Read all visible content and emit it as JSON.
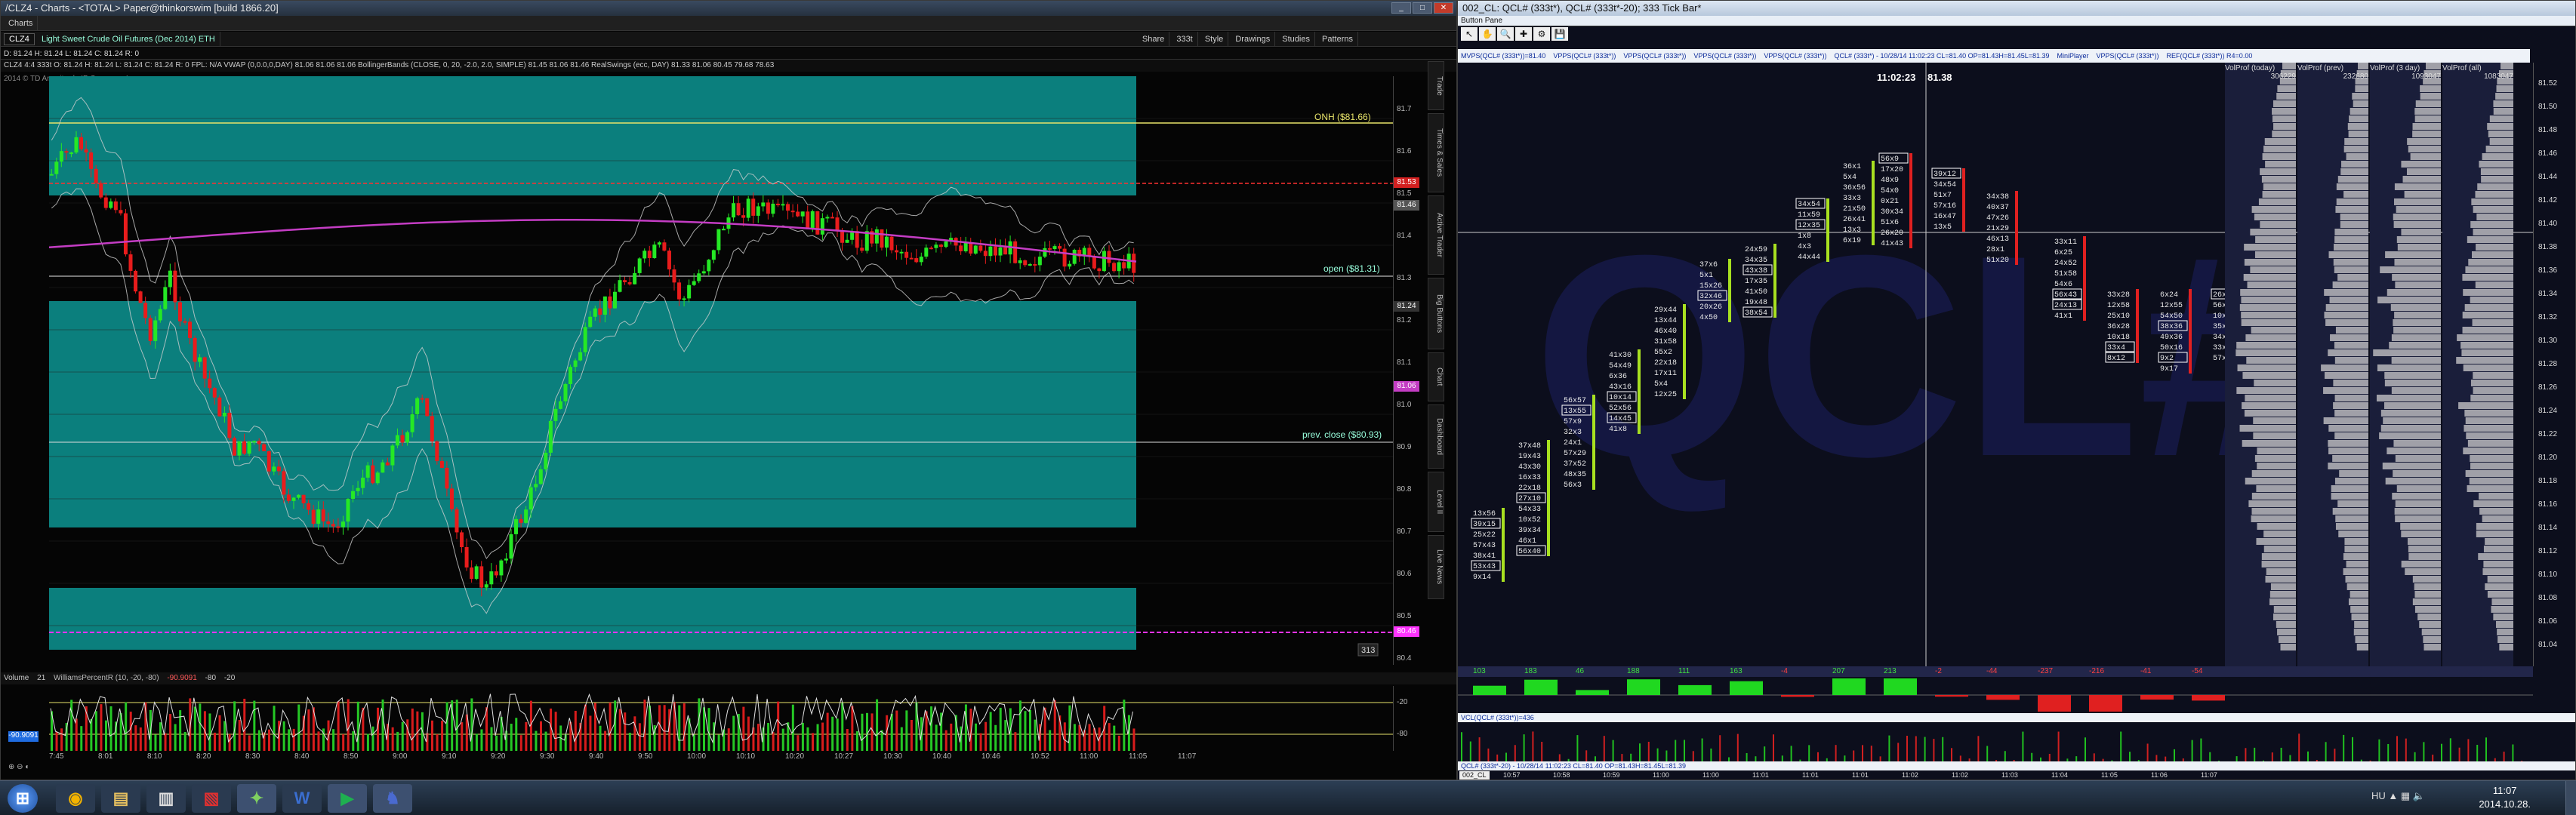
{
  "left": {
    "title": "/CLZ4 - Charts - <TOTAL> Paper@thinkorswim [build 1866.20]",
    "charts_label": "Charts",
    "symbol": "CLZ4",
    "description": "Light Sweet Crude Oil Futures (Dec 2014) ETH",
    "quote": "D: 81.24  H: 81.24  L: 81.24  C: 81.24  R: 0",
    "tools": [
      "Share",
      "333t",
      "Style",
      "Drawings",
      "Studies",
      "Patterns"
    ],
    "studies_line": "CLZ4 4:4 333t   O: 81.24  H: 81.24  L: 81.24  C: 81.24  R: 0   FPL: N/A   VWAP (0,0.0,0,DAY)  81.06  81.06  81.06   BollingerBands (CLOSE, 0, 20, -2.0, 2.0, SIMPLE)  81.45  81.06  81.46   RealSwings (ecc, DAY)  81.33  81.06  80.45  79.68  78.63",
    "copyright": "2014 © TD Ameritrade IP Company, Inc.",
    "labels": {
      "onh": "ONH ($81.66)",
      "open": "open ($81.31)",
      "prev_close": "prev. close ($80.93)"
    },
    "price_ticks": [
      "81.7",
      "81.6",
      "81.5",
      "81.4",
      "81.3",
      "81.2",
      "81.1",
      "81.0",
      "80.9",
      "80.8",
      "80.7",
      "80.6",
      "80.5",
      "80.4"
    ],
    "price_cells": {
      "p1": "81.53",
      "p2": "81.46",
      "p3": "81.24",
      "p4": "81.06",
      "p5": "80.46"
    },
    "count_badge": "313",
    "lower_study": {
      "volume": "Volume",
      "vol_val": "21",
      "label": "WilliamsPercentR (10, -20, -80)",
      "val": "-90.9091",
      "l1": "-80",
      "l2": "-20"
    },
    "lower_ticks": [
      "-20",
      "-80"
    ],
    "time_ticks": [
      "7:45",
      "8:01",
      "8:10",
      "8:20",
      "8:30",
      "8:40",
      "8:50",
      "9:00",
      "9:10",
      "9:20",
      "9:30",
      "9:40",
      "9:50",
      "10:00",
      "10:10",
      "10:20",
      "10:27",
      "10:30",
      "10:40",
      "10:46",
      "10:52",
      "11:00",
      "11:05",
      "11:07"
    ],
    "side_tabs": [
      "Trade",
      "Times & Sales",
      "Active Trader",
      "Big Buttons",
      "Chart",
      "Dashboard",
      "Level II",
      "Live News"
    ],
    "colors": {
      "teal": "#0b7f7d",
      "up": "#25e825",
      "down": "#e81c1c",
      "vwap": "#c43dc4"
    }
  },
  "right": {
    "title": "002_CL: QCL# (333t*), QCL# (333t*-20); 333 Tick Bar*",
    "menu": "Button Pane",
    "header_items": [
      "MVPS(QCL# (333t*))=81.40",
      "VPPS(QCL# (333t*))",
      "VPPS(QCL# (333t*))",
      "VPPS(QCL# (333t*))",
      "VPPS(QCL# (333t*))",
      "QCL# (333t*) - 10/28/14 11:02:23 CL=81.40 OP=81.43H=81.45L=81.39",
      "MiniPlayer",
      "VPPS(QCL# (333t*))",
      "REF(QCL# (333t*)) R4=0.00"
    ],
    "crosshair_time": "11:02:23",
    "crosshair_price": "81.38",
    "profile_headers": [
      "VolProf (today)",
      "VolProf (prev)",
      "VolProf (3 day)",
      "VolProf (all)"
    ],
    "profile_values": [
      "306229",
      "232680",
      "1093047",
      "1083047"
    ],
    "price_axis": [
      "81.52",
      "81.50",
      "81.48",
      "81.46",
      "81.44",
      "81.42",
      "81.40",
      "81.38",
      "81.36",
      "81.34",
      "81.32",
      "81.30",
      "81.28",
      "81.26",
      "81.24",
      "81.22",
      "81.20",
      "81.18",
      "81.16",
      "81.14",
      "81.12",
      "81.10",
      "81.08",
      "81.06",
      "81.04"
    ],
    "delta_values": [
      "103",
      "183",
      "46",
      "188",
      "111",
      "163",
      "-4",
      "207",
      "213",
      "-2",
      "-44",
      "-237",
      "-216",
      "-41",
      "-54"
    ],
    "mid_label": "VCL(QCL# (333t*))=436",
    "bottom_label": "QCL# (333t*-20) - 10/28/14 11:02:23 CL=81.40 OP=81.43H=81.45L=81.39",
    "time_axis": [
      "10:57",
      "10:58",
      "10:59",
      "11:00",
      "11:00",
      "11:01",
      "11:01",
      "11:01",
      "11:02",
      "11:02",
      "11:03",
      "11:04",
      "11:05",
      "11:06",
      "11:07"
    ],
    "tab": "002_CL"
  },
  "taskbar": {
    "lang": "HU",
    "time": "11:07",
    "date": "2014.10.28."
  }
}
